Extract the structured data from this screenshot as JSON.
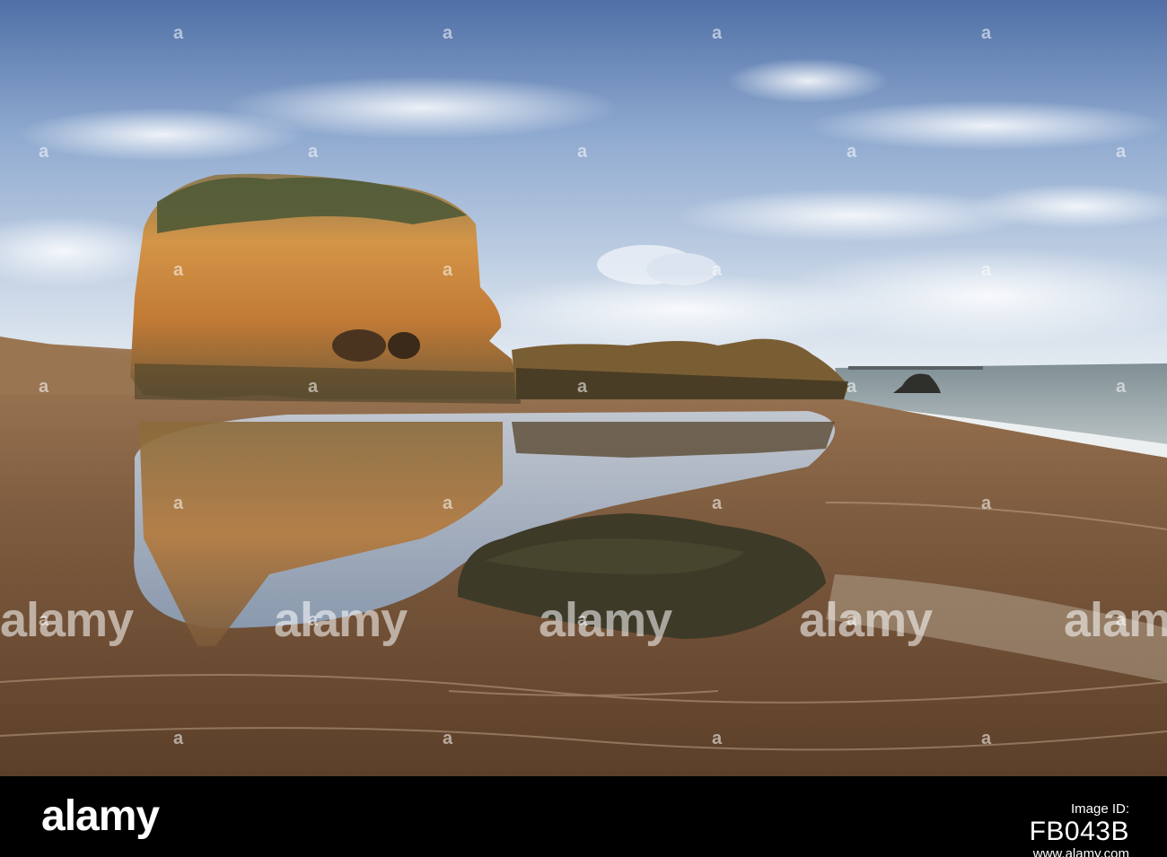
{
  "photo": {
    "subject": "",
    "watermark_brand": "alamy"
  },
  "footer": {
    "logo": "alamy",
    "tagline": "",
    "image_id_label": "Image ID:",
    "image_id": "FB043B",
    "site": "www.alamy.com"
  },
  "colors": {
    "footer_bg": "#000000",
    "sky_top": "#5b7bb0",
    "sky_mid": "#a8bfdc",
    "sand": "#8a6a4c",
    "rock_orange": "#c98a45"
  }
}
